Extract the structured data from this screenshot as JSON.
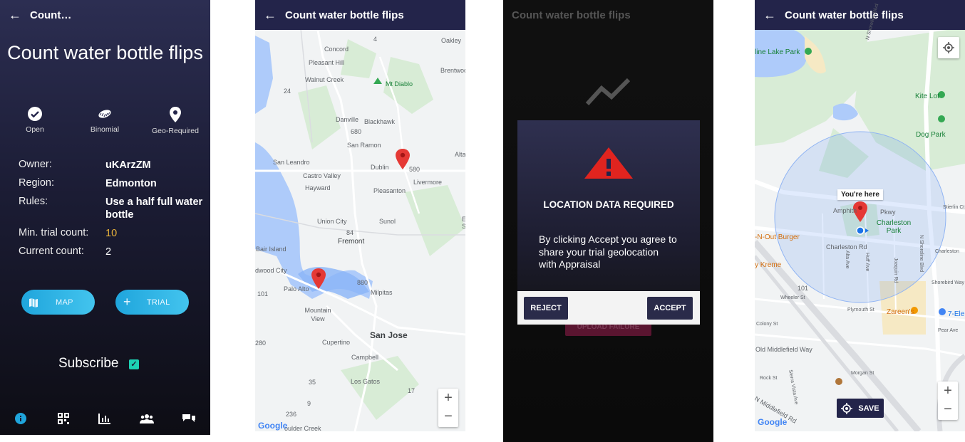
{
  "screen1": {
    "title": "Count…",
    "big_title": "Count water bottle flips",
    "features": [
      {
        "label": "Open",
        "icon": "check-circle-icon"
      },
      {
        "label": "Binomial",
        "icon": "bottle-cap-icon"
      },
      {
        "label": "Geo-Required",
        "icon": "location-pin-icon"
      }
    ],
    "details": [
      {
        "key": "Owner:",
        "value": "uKArzZM"
      },
      {
        "key": "Region:",
        "value": "Edmonton"
      },
      {
        "key": "Rules:",
        "value": "Use a half full water bottle"
      },
      {
        "key": "Min. trial count:",
        "value": "10"
      },
      {
        "key": "Current count:",
        "value": "2"
      }
    ],
    "map_button": "MAP",
    "trial_button": "TRIAL",
    "subscribe_label": "Subscribe",
    "nav_icons": [
      "info-icon",
      "qr-code-icon",
      "bar-chart-icon",
      "people-icon",
      "chat-icon"
    ],
    "colors": {
      "accent": "#1fa5dc",
      "min_count": "#e8b23a",
      "checkbox": "#1dd1b3"
    }
  },
  "screen2": {
    "title": "Count water bottle flips",
    "labels": {
      "concord": "Concord",
      "pleasant_hill": "Pleasant Hill",
      "walnut_creek": "Walnut Creek",
      "mt_diablo": "Mt Diablo",
      "danville": "Danville",
      "blackhawk": "Blackhawk",
      "san_ramon": "San Ramon",
      "dublin": "Dublin",
      "livermore": "Livermore",
      "san_leandro": "San Leandro",
      "castro_valley": "Castro Valley",
      "hayward": "Hayward",
      "pleasanton": "Pleasanton",
      "union_city": "Union City",
      "sunol": "Sunol",
      "fremont": "Fremont",
      "bair_island": "Bair Island",
      "redwood_city": "dwood City",
      "palo_alto": "Palo Alto",
      "milpitas": "Milpitas",
      "mountain_view": "Mountain View",
      "san_jose": "San Jose",
      "cupertino": "Cupertino",
      "campbell": "Campbell",
      "los_gatos": "Los Gatos",
      "boulder_creek": "oulder Creek",
      "oakley": "Oakley",
      "brentwood": "Brentwood",
      "alta": "Alta",
      "r4": "4",
      "r24": "24",
      "r680": "680",
      "r580": "580",
      "r84": "84",
      "r880": "880",
      "r101": "101",
      "r280": "280",
      "r35": "35",
      "r236": "236",
      "r9": "9",
      "r17": "17",
      "e": "E",
      "s": "S"
    },
    "zoom_in": "+",
    "zoom_out": "−",
    "google": "Google"
  },
  "screen3": {
    "title": "Count water bottle flips",
    "dialog_title": "LOCATION DATA REQUIRED",
    "dialog_body": "By clicking Accept you agree to share your trial geolocation with Appraisal",
    "reject": "REJECT",
    "accept": "ACCEPT",
    "behind_button": "UPLOAD FAILURE"
  },
  "screen4": {
    "title": "Count water bottle flips",
    "labels": {
      "pine_lake_park": "line Lake Park",
      "kite_lot": "Kite Lot",
      "dog_park": "Dog Park",
      "you_are_here": "You're here",
      "amphitheatre": "Amphith",
      "pkwy": "Pkwy",
      "charleston_park": "Charleston Park",
      "charleston_rd": "Charleston Rd",
      "charleston_rd2": "Charleston",
      "in_n_out": "-N-Out Burger",
      "krispy": "y Kreme",
      "stierlin": "Stierlin Ct",
      "n_shoreline": "N Shoreline Blvd",
      "shoreline_top": "N Shoreline Blvd",
      "alta_ave": "Alta Ave",
      "huff_ave": "Huff Ave",
      "joaquin_rd": "Joaquin Rd",
      "plymouth": "Plymouth St",
      "zareens": "Zareen's",
      "seven_eleven": "7-Ele",
      "colony": "Colony St",
      "pear": "Pear Ave",
      "old_middlefield": "Old Middlefield Way",
      "shorebird": "Shorebird Way",
      "rock": "Rock St",
      "morgan": "Morgan St",
      "sierra": "Sierra Vista Ave",
      "n_middlefield": "N Middlefield Rd",
      "wheeler": "Wheeler St",
      "r101": "101"
    },
    "save": "SAVE",
    "zoom_in": "+",
    "zoom_out": "−",
    "google": "Google"
  }
}
